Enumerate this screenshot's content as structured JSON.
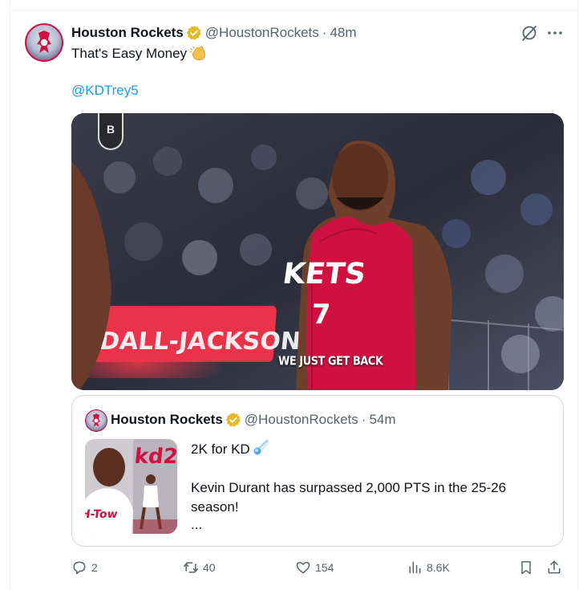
{
  "tweet": {
    "author_name": "Houston Rockets",
    "handle": "@HoustonRockets",
    "separator": "·",
    "time": "48m",
    "text": "That's Easy Money",
    "text_emoji": "clapping-hands-icon",
    "mention": "@KDTrey5",
    "video_caption": "WE JUST GET BACK"
  },
  "quoted": {
    "author_name": "Houston Rockets",
    "handle": "@HoustonRockets",
    "separator": "·",
    "time": "54m",
    "line1": "2K for KD",
    "line1_emoji": "comet-icon",
    "line2": "Kevin Durant has surpassed 2,000 PTS in the 25-26 season!",
    "ellipsis": "..."
  },
  "actions": {
    "replies": "2",
    "reposts": "40",
    "likes": "154",
    "views": "8.6K"
  },
  "colors": {
    "text": "#0f1419",
    "muted": "#536471",
    "link": "#1d9bf0",
    "verified_gold": "#e8b829",
    "border": "#cfd9de",
    "rockets_red": "#ce1141"
  }
}
